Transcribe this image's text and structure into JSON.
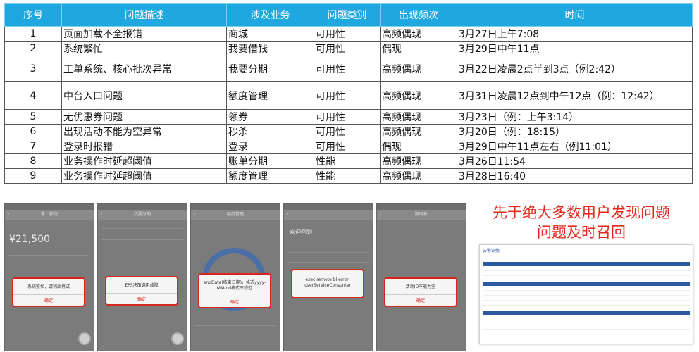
{
  "table": {
    "headers": [
      "序号",
      "问题描述",
      "涉及业务",
      "问题类别",
      "出现频次",
      "时间"
    ],
    "rows": [
      {
        "no": "1",
        "desc": "页面加载不全报错",
        "biz": "商城",
        "category": "可用性",
        "freq": "高频偶现",
        "time": "3月27日上午7:08"
      },
      {
        "no": "2",
        "desc": "系统繁忙",
        "biz": "我要借钱",
        "category": "可用性",
        "freq": "偶现",
        "time": "3月29日中午11点"
      },
      {
        "no": "3",
        "desc": "工单系统、核心批次异常",
        "biz": "我要分期",
        "category": "可用性",
        "freq": "高频偶现",
        "time": "3月22日凌晨2点半到3点（例2:42）"
      },
      {
        "no": "4",
        "desc": "中台入口问题",
        "biz": "额度管理",
        "category": "可用性",
        "freq": "高频偶现",
        "time": "3月31日凌晨12点到中午12点（例：12:42）"
      },
      {
        "no": "5",
        "desc": "无优惠券问题",
        "biz": "领券",
        "category": "可用性",
        "freq": "高频偶现",
        "time": "3月23日（例：上午3:14）"
      },
      {
        "no": "6",
        "desc": "出现活动不能为空异常",
        "biz": "秒杀",
        "category": "可用性",
        "freq": "高频偶现",
        "time": "3月20日（例：18:15）"
      },
      {
        "no": "7",
        "desc": "登录时报错",
        "biz": "登录",
        "category": "可用性",
        "freq": "偶现",
        "time": "3月29日中午11点左右（例11:01）"
      },
      {
        "no": "8",
        "desc": "业务操作时延超阈值",
        "biz": "账单分期",
        "category": "性能",
        "freq": "高频偶现",
        "time": "3月26日11:54"
      },
      {
        "no": "9",
        "desc": "业务操作时延超阈值",
        "biz": "额度管理",
        "category": "性能",
        "freq": "高频偶现",
        "time": "3月28日16:40"
      }
    ]
  },
  "phones": [
    {
      "title": "掌上影院",
      "amount": "¥21,500",
      "message": "系统繁忙，请稍后再试",
      "ok": "确定"
    },
    {
      "title": "我要分期",
      "message": "EPS决策调用故障",
      "ok": "确定"
    },
    {
      "title": "额度管理",
      "message": "endDate(结束日期)，格式yyyy-MM-dd格式不规范",
      "ok": "确定"
    },
    {
      "title": "",
      "welcome": "欢迎回到",
      "message": "exec remote bl error: userServiceConsumer",
      "ok": ""
    },
    {
      "title": "限时秒",
      "message": "活动ID不能为空",
      "ok": "确定"
    }
  ],
  "headline": {
    "line1": "先于绝大多数用户发现问题",
    "line2": "问题及时召回"
  },
  "alert_panel": {
    "title": "告警详情"
  },
  "colors": {
    "header_bg": "#1fa8e0",
    "headline": "#e6291e",
    "dialog_border": "#d9261c"
  }
}
